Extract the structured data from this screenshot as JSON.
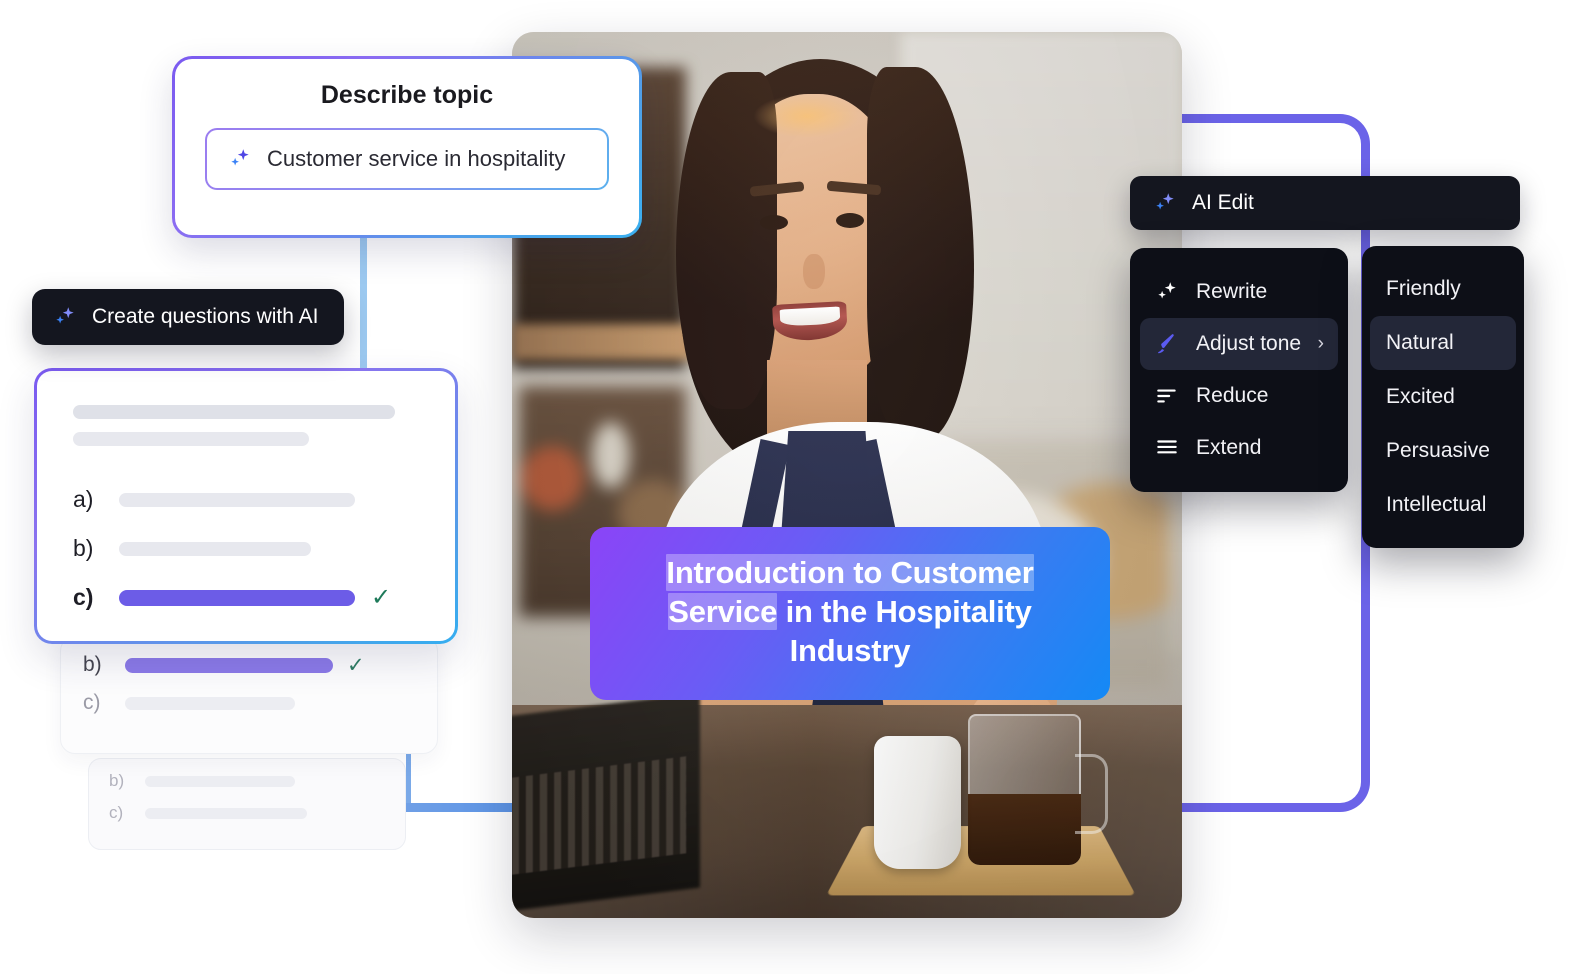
{
  "describe_card": {
    "title": "Describe topic",
    "field": {
      "value": "Customer service in hospitality",
      "icon": "sparkle-icon"
    }
  },
  "create_pill": {
    "label": "Create questions with AI",
    "icon": "sparkle-icon"
  },
  "quiz": {
    "front": {
      "options": [
        {
          "label": "a)",
          "state": "empty",
          "checked": false
        },
        {
          "label": "b)",
          "state": "empty",
          "checked": false
        },
        {
          "label": "c)",
          "state": "selected",
          "checked": true
        }
      ],
      "check_glyph": "✓"
    },
    "back1": {
      "options": [
        {
          "label": "b)",
          "state": "selected",
          "checked": true
        },
        {
          "label": "c)",
          "state": "empty",
          "checked": false
        }
      ],
      "check_glyph": "✓"
    },
    "back2": {
      "options": [
        {
          "label": "b)",
          "state": "empty",
          "checked": false
        },
        {
          "label": "c)",
          "state": "empty",
          "checked": false
        }
      ]
    }
  },
  "slide": {
    "title_line1": "Introduction to Customer",
    "title_line2_selected": "Service",
    "title_line2_rest": " in the Hospitality",
    "title_line3": "Industry",
    "banner_gradient_from": "#8b44f7",
    "banner_gradient_to": "#1489f5",
    "photo_alt": "Smiling barista in white t-shirt and navy apron at a cafe counter with a white cup and glass coffee carafe on a wooden board"
  },
  "ai_edit": {
    "header": {
      "label": "AI Edit",
      "icon": "sparkle-icon"
    },
    "menu_items": [
      {
        "label": "Rewrite",
        "icon": "sparkle-icon",
        "active": false,
        "has_submenu": false
      },
      {
        "label": "Adjust tone",
        "icon": "magic-pen-icon",
        "active": true,
        "has_submenu": true
      },
      {
        "label": "Reduce",
        "icon": "reduce-icon",
        "active": false,
        "has_submenu": false
      },
      {
        "label": "Extend",
        "icon": "extend-icon",
        "active": false,
        "has_submenu": false
      }
    ],
    "chevron_glyph": "›",
    "tones": [
      {
        "label": "Friendly",
        "active": false
      },
      {
        "label": "Natural",
        "active": true
      },
      {
        "label": "Excited",
        "active": false
      },
      {
        "label": "Persuasive",
        "active": false
      },
      {
        "label": "Intellectual",
        "active": false
      }
    ]
  },
  "colors": {
    "accent_purple": "#6c5ce7",
    "accent_blue": "#1489f5",
    "menu_bg": "#0d0f17",
    "check_green": "#1e7a5a"
  }
}
